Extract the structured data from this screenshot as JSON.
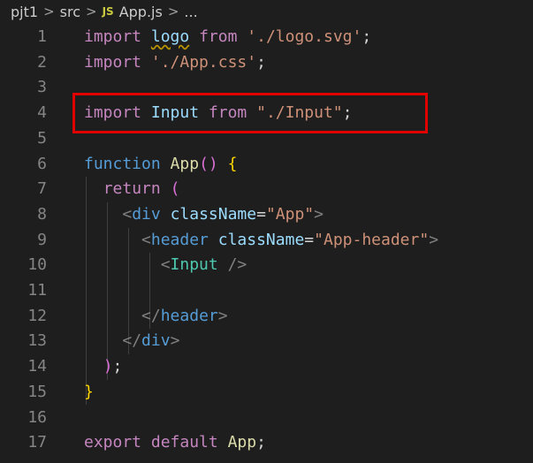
{
  "breadcrumb": {
    "folder": "pjt1",
    "subfolder": "src",
    "file_icon": "JS",
    "file": "App.js",
    "more": "..."
  },
  "lines": [
    {
      "num": "1",
      "tokens": [
        [
          "kw",
          "import"
        ],
        [
          "plain",
          " "
        ],
        [
          "var",
          "logo"
        ],
        [
          "plain",
          " "
        ],
        [
          "kw",
          "from"
        ],
        [
          "plain",
          " "
        ],
        [
          "str",
          "'./logo.svg'"
        ],
        [
          "plain",
          ";"
        ]
      ]
    },
    {
      "num": "2",
      "tokens": [
        [
          "kw",
          "import"
        ],
        [
          "plain",
          " "
        ],
        [
          "str",
          "'./App.css'"
        ],
        [
          "plain",
          ";"
        ]
      ]
    },
    {
      "num": "3",
      "tokens": []
    },
    {
      "num": "4",
      "tokens": [
        [
          "kw",
          "import"
        ],
        [
          "plain",
          " "
        ],
        [
          "var",
          "Input"
        ],
        [
          "plain",
          " "
        ],
        [
          "kw",
          "from"
        ],
        [
          "plain",
          " "
        ],
        [
          "str",
          "\"./Input\""
        ],
        [
          "plain",
          ";"
        ]
      ]
    },
    {
      "num": "5",
      "tokens": []
    },
    {
      "num": "6",
      "tokens": [
        [
          "tag",
          "function"
        ],
        [
          "plain",
          " "
        ],
        [
          "fn",
          "App"
        ],
        [
          "brk2",
          "()"
        ],
        [
          "plain",
          " "
        ],
        [
          "brk",
          "{"
        ]
      ]
    },
    {
      "num": "7",
      "tokens": [
        [
          "plain",
          "  "
        ],
        [
          "kw",
          "return"
        ],
        [
          "plain",
          " "
        ],
        [
          "brk2",
          "("
        ]
      ]
    },
    {
      "num": "8",
      "tokens": [
        [
          "plain",
          "    "
        ],
        [
          "punct",
          "<"
        ],
        [
          "tag",
          "div"
        ],
        [
          "plain",
          " "
        ],
        [
          "attr",
          "className"
        ],
        [
          "plain",
          "="
        ],
        [
          "str",
          "\"App\""
        ],
        [
          "punct",
          ">"
        ]
      ]
    },
    {
      "num": "9",
      "tokens": [
        [
          "plain",
          "      "
        ],
        [
          "punct",
          "<"
        ],
        [
          "tag",
          "header"
        ],
        [
          "plain",
          " "
        ],
        [
          "attr",
          "className"
        ],
        [
          "plain",
          "="
        ],
        [
          "str",
          "\"App-header\""
        ],
        [
          "punct",
          ">"
        ]
      ]
    },
    {
      "num": "10",
      "tokens": [
        [
          "plain",
          "        "
        ],
        [
          "punct",
          "<"
        ],
        [
          "comp",
          "Input"
        ],
        [
          "plain",
          " "
        ],
        [
          "punct",
          "/>"
        ]
      ]
    },
    {
      "num": "11",
      "tokens": []
    },
    {
      "num": "12",
      "tokens": [
        [
          "plain",
          "      "
        ],
        [
          "punct",
          "</"
        ],
        [
          "tag",
          "header"
        ],
        [
          "punct",
          ">"
        ]
      ]
    },
    {
      "num": "13",
      "tokens": [
        [
          "plain",
          "    "
        ],
        [
          "punct",
          "</"
        ],
        [
          "tag",
          "div"
        ],
        [
          "punct",
          ">"
        ]
      ]
    },
    {
      "num": "14",
      "tokens": [
        [
          "plain",
          "  "
        ],
        [
          "brk2",
          ")"
        ],
        [
          "plain",
          ";"
        ]
      ]
    },
    {
      "num": "15",
      "tokens": [
        [
          "brk",
          "}"
        ]
      ]
    },
    {
      "num": "16",
      "tokens": []
    },
    {
      "num": "17",
      "tokens": [
        [
          "kw",
          "export"
        ],
        [
          "plain",
          " "
        ],
        [
          "kw",
          "default"
        ],
        [
          "plain",
          " "
        ],
        [
          "fn",
          "App"
        ],
        [
          "plain",
          ";"
        ]
      ]
    }
  ],
  "highlighted_line": "4",
  "squiggle_token": "logo"
}
